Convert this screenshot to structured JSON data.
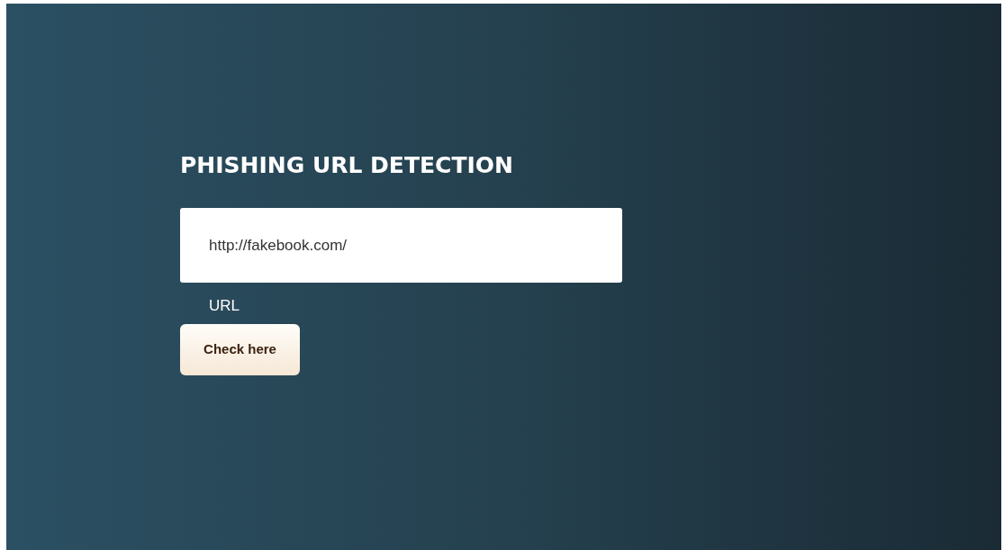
{
  "title": "PHISHING URL DETECTION",
  "url_field": {
    "value": "http://fakebook.com/",
    "label": "URL"
  },
  "submit_button": {
    "label": "Check here"
  }
}
